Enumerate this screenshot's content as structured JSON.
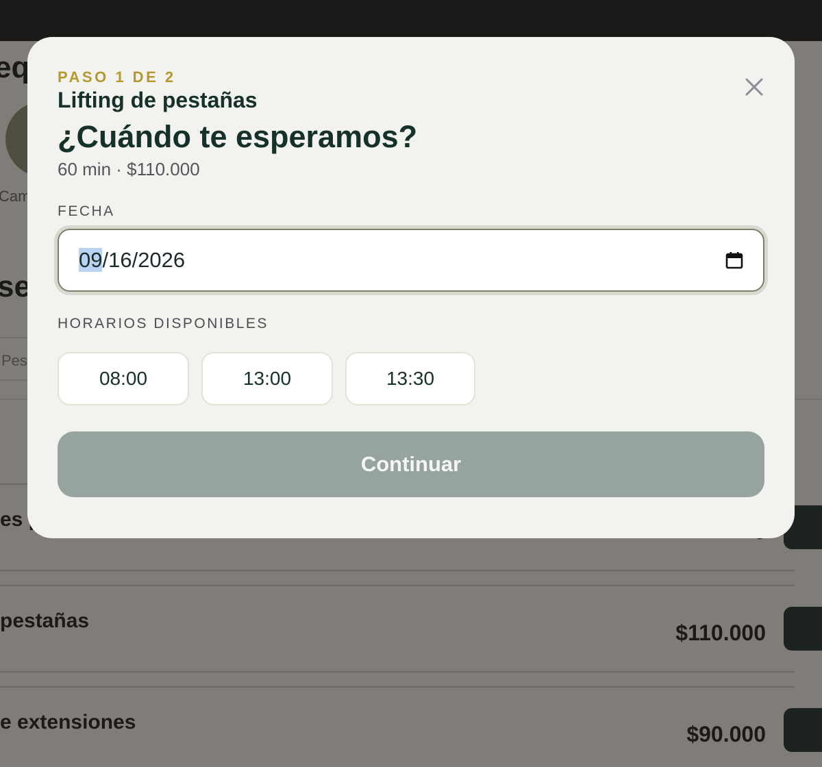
{
  "background": {
    "heading_fragment": "eq",
    "caption_fragment": "Cam",
    "heading2_fragment": "sei",
    "search_fragment": "Pes",
    "cards": [
      {
        "title": "es p",
        "price": "0"
      },
      {
        "title": "pestañas",
        "price": "$110.000"
      },
      {
        "title": "e extensiones",
        "price": "$90.000"
      }
    ]
  },
  "modal": {
    "step": "PASO 1 DE 2",
    "service": "Lifting de pestañas",
    "title": "¿Cuándo te esperamos?",
    "meta": "60 min · $110.000",
    "date_label": "FECHA",
    "date": {
      "month": "09",
      "rest": "/16/2026"
    },
    "slots_label": "HORARIOS DISPONIBLES",
    "slots": [
      "08:00",
      "13:00",
      "13:30"
    ],
    "continue_label": "Continuar"
  },
  "colors": {
    "accent_gold": "#b5992f",
    "heading_green": "#16302a",
    "disabled_button": "#97a39e"
  },
  "icons": {
    "close": "close-icon",
    "calendar": "calendar-icon"
  }
}
